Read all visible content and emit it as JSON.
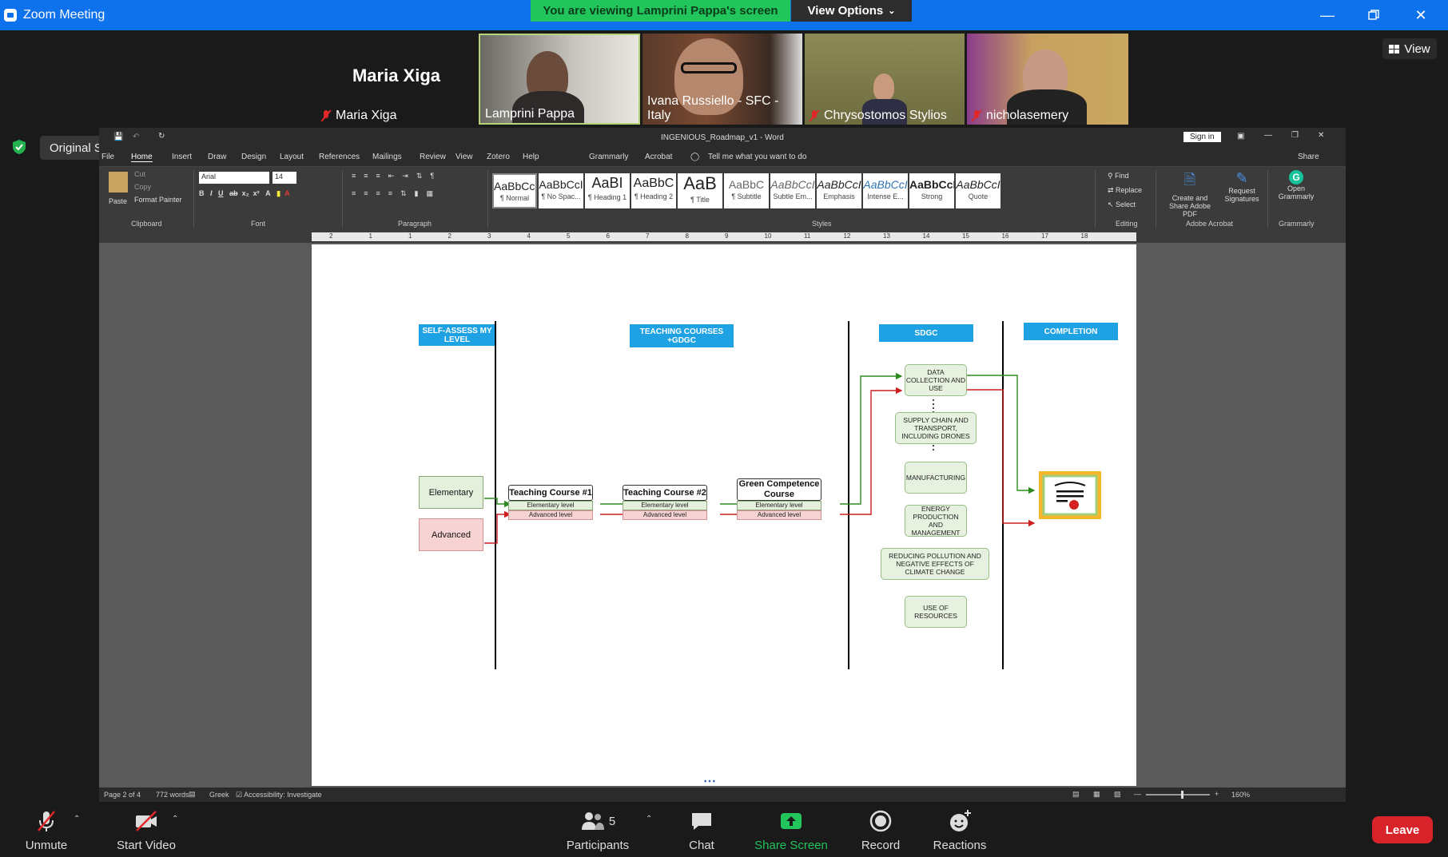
{
  "zoom": {
    "window_title": "Zoom Meeting",
    "viewing_banner": "You are viewing Lamprini Pappa's screen",
    "view_options": "View Options",
    "view_button": "View",
    "original_sound": "Original Sound: Off"
  },
  "participants_gallery": [
    {
      "name": "Maria Xiga",
      "muted": true,
      "video": false,
      "display_name_big": "Maria Xiga"
    },
    {
      "name": "Lamprini Pappa",
      "muted": false,
      "video": true
    },
    {
      "name": "Ivana Russiello - SFC - Italy",
      "muted": false,
      "video": true
    },
    {
      "name": "Chrysostomos Stylios",
      "muted": true,
      "video": true
    },
    {
      "name": "nicholasemery",
      "muted": true,
      "video": true
    }
  ],
  "word": {
    "doc_title": "INGENIOUS_Roadmap_v1 - Word",
    "sign_in": "Sign in",
    "share": "Share",
    "tabs": [
      "File",
      "Home",
      "Insert",
      "Draw",
      "Design",
      "Layout",
      "References",
      "Mailings",
      "Review",
      "View",
      "Zotero",
      "Help",
      "Grammarly",
      "Acrobat"
    ],
    "tell_me": "Tell me what you want to do",
    "clipboard": {
      "paste": "Paste",
      "cut": "Cut",
      "copy": "Copy",
      "format_painter": "Format Painter",
      "label": "Clipboard"
    },
    "font": {
      "name": "Arial",
      "size": "14",
      "label": "Font"
    },
    "paragraph_label": "Paragraph",
    "styles_label": "Styles",
    "styles": [
      {
        "preview": "AaBbCcI",
        "name": "¶ Normal"
      },
      {
        "preview": "AaBbCcI",
        "name": "¶ No Spac..."
      },
      {
        "preview": "AaBI",
        "name": "¶ Heading 1"
      },
      {
        "preview": "AaBbC",
        "name": "¶ Heading 2"
      },
      {
        "preview": "AaB",
        "name": "¶ Title"
      },
      {
        "preview": "AaBbC",
        "name": "¶ Subtitle"
      },
      {
        "preview": "AaBbCcI",
        "name": "Subtle Em..."
      },
      {
        "preview": "AaBbCcI",
        "name": "Emphasis"
      },
      {
        "preview": "AaBbCcI",
        "name": "Intense E..."
      },
      {
        "preview": "AaBbCcI",
        "name": "Strong"
      },
      {
        "preview": "AaBbCcI",
        "name": "Quote"
      }
    ],
    "editing": {
      "find": "Find",
      "replace": "Replace",
      "select": "Select",
      "label": "Editing"
    },
    "acrobat": {
      "create_share": "Create and Share Adobe PDF",
      "request_signatures": "Request Signatures",
      "label": "Adobe Acrobat"
    },
    "grammarly": {
      "open": "Open Grammarly",
      "label": "Grammarly"
    },
    "ruler_numbers": [
      "2",
      "1",
      "1",
      "2",
      "3",
      "4",
      "5",
      "6",
      "7",
      "8",
      "9",
      "10",
      "11",
      "12",
      "13",
      "14",
      "15",
      "16",
      "17",
      "18"
    ],
    "status": {
      "page": "Page 2 of 4",
      "words": "772 words",
      "language": "Greek",
      "accessibility": "Accessibility: Investigate",
      "zoom": "160%"
    }
  },
  "diagram": {
    "headers": {
      "self_assess": "SELF-ASSESS MY LEVEL",
      "teaching": "TEACHING COURSES +GDGC",
      "sdgc": "SDGC",
      "completion": "COMPLETION"
    },
    "levels": {
      "elementary": "Elementary",
      "advanced": "Advanced"
    },
    "courses": [
      {
        "title": "Teaching Course #1",
        "sub1": "Elementary level",
        "sub2": "Advanced level"
      },
      {
        "title": "Teaching Course #2",
        "sub1": "Elementary level",
        "sub2": "Advanced level"
      },
      {
        "title": "Green Competence Course",
        "sub1": "Elementary level",
        "sub2": "Advanced level"
      }
    ],
    "sdgc_nodes": [
      "DATA COLLECTION AND USE",
      "SUPPLY CHAIN AND TRANSPORT, INCLUDING DRONES",
      "MANUFACTURING",
      "ENERGY PRODUCTION AND MANAGEMENT",
      "REDUCING POLLUTION AND NEGATIVE EFFECTS OF CLIMATE CHANGE",
      "USE OF RESOURCES"
    ],
    "colors": {
      "header": "#1ea2e4",
      "green_arrow": "#2e8b1e",
      "red_arrow": "#cc1f1f",
      "node_fill": "#e7f1df"
    }
  },
  "toolbar": {
    "unmute": "Unmute",
    "start_video": "Start Video",
    "participants": "Participants",
    "participants_count": "5",
    "chat": "Chat",
    "share_screen": "Share Screen",
    "record": "Record",
    "reactions": "Reactions",
    "leave": "Leave"
  }
}
